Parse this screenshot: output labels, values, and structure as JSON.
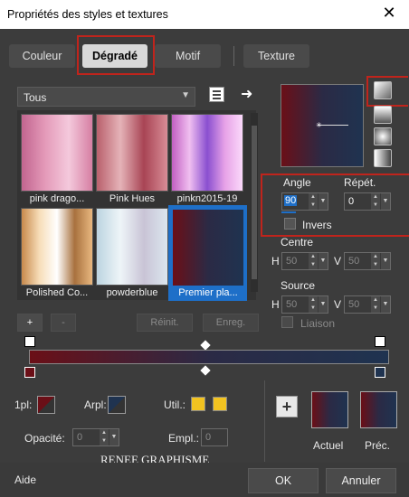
{
  "window": {
    "title": "Propriétés des styles et textures",
    "close": "✕"
  },
  "tabs": [
    "Couleur",
    "Dégradé",
    "Motif",
    "Texture"
  ],
  "category": {
    "value": "Tous"
  },
  "gradients": [
    {
      "label": "pink drago..."
    },
    {
      "label": "Pink Hues"
    },
    {
      "label": "pinkn2015-19"
    },
    {
      "label": "Polished Co..."
    },
    {
      "label": "powderblue"
    },
    {
      "label": "Premier pla..."
    }
  ],
  "angle": {
    "label": "Angle",
    "value": "90"
  },
  "repeat": {
    "label": "Répét.",
    "value": "0"
  },
  "invert": {
    "label": "Invers"
  },
  "centre": {
    "label": "Centre",
    "h_label": "H",
    "h": "50",
    "v_label": "V",
    "v": "50"
  },
  "source": {
    "label": "Source",
    "h_label": "H",
    "h": "50",
    "v_label": "V",
    "v": "50"
  },
  "link": {
    "label": "Liaison"
  },
  "editbar": {
    "add": "+",
    "remove": "-",
    "reset": "Réinit.",
    "save": "Enreg."
  },
  "bottom": {
    "fg_label": "1pl:",
    "bg_label": "Arpl:",
    "util_label": "Util.:",
    "opacity_label": "Opacité:",
    "opacity": "0",
    "location_label": "Empl.:",
    "location": "0",
    "watermark": "RENEE GRAPHISME",
    "plus": "+",
    "current_label": "Actuel",
    "previous_label": "Préc."
  },
  "footer": {
    "help": "Aide",
    "ok": "OK",
    "cancel": "Annuler"
  },
  "colors": {
    "dark_red": "#6b0f17",
    "navy": "#1f3350",
    "accent_red": "#c0241c",
    "yellow": "#f2c320",
    "blue_select": "#1e6fc8"
  }
}
